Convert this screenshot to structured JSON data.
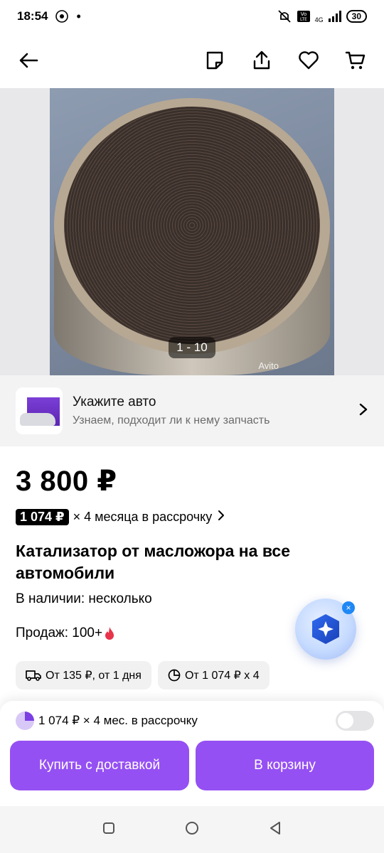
{
  "status": {
    "time": "18:54",
    "battery": "30",
    "network": "4G"
  },
  "gallery": {
    "counter": "1 - 10",
    "watermark": "Avito"
  },
  "car_banner": {
    "title": "Укажите авто",
    "subtitle": "Узнаем, подходит ли к нему запчасть"
  },
  "product": {
    "price": "3 800 ₽",
    "installment_badge": "1 074 ₽",
    "installment_text": "× 4 месяца в рассрочку",
    "title": "Катализатор от масложора на все автомобили",
    "stock": "В наличии: несколько",
    "sales": "Продаж: 100+"
  },
  "chips": [
    {
      "label": "От 135 ₽, от 1 дня",
      "icon": "truck-icon"
    },
    {
      "label": "От 1 074 ₽ х 4",
      "icon": "pie-icon"
    }
  ],
  "bottom": {
    "installment_label": "1 074 ₽ × 4 мес. в рассрочку",
    "buy_label": "Купить с доставкой",
    "cart_label": "В корзину"
  },
  "colors": {
    "accent": "#9550f3",
    "toggle": "#e4e4e6"
  }
}
